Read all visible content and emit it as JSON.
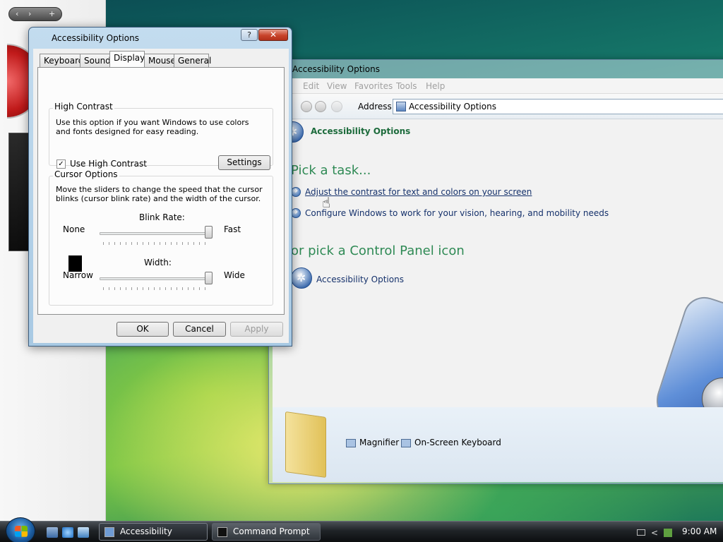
{
  "desktop": {
    "sidebar_controls": {
      "prev": "‹",
      "next": "›",
      "add": "+"
    }
  },
  "explorer": {
    "title": "Accessibility Options",
    "menu": [
      "Edit",
      "View",
      "Favorites",
      "Tools",
      "Help"
    ],
    "address_label": "Address",
    "address_value": "Accessibility Options",
    "header_link": "Accessibility Options",
    "pick_task": "Pick a task...",
    "tasks": [
      "Adjust the contrast for text and colors on your screen",
      "Configure Windows to work for your vision, hearing, and mobility needs"
    ],
    "pick_icon": "or pick a Control Panel icon",
    "cp_icon_label": "Accessibility Options",
    "bottom_items": [
      "Magnifier",
      "On-Screen Keyboard"
    ]
  },
  "dialog": {
    "title": "Accessibility Options",
    "help_glyph": "?",
    "close_glyph": "✕",
    "tabs": [
      "Keyboard",
      "Sound",
      "Display",
      "Mouse",
      "General"
    ],
    "active_tab": "Display",
    "high_contrast": {
      "group_title": "High Contrast",
      "description": "Use this option if you want Windows to use colors and fonts designed for easy reading.",
      "checkbox_label": "Use High Contrast",
      "checkbox_checked": true,
      "checkbox_glyph": "✓",
      "settings_button": "Settings"
    },
    "cursor_options": {
      "group_title": "Cursor Options",
      "description": "Move the sliders to change the speed that the cursor blinks (cursor blink rate) and the width of the cursor.",
      "blink_rate": {
        "label": "Blink Rate:",
        "min_label": "None",
        "max_label": "Fast",
        "value_fraction": 1.0
      },
      "width": {
        "label": "Width:",
        "min_label": "Narrow",
        "max_label": "Wide",
        "value_fraction": 1.0
      }
    },
    "buttons": {
      "ok": "OK",
      "cancel": "Cancel",
      "apply": "Apply"
    }
  },
  "taskbar": {
    "items": [
      {
        "label": "Accessibility Options",
        "active": true
      },
      {
        "label": "Command Prompt",
        "active": false
      }
    ],
    "tray_chevron": "<",
    "clock": "9:00 AM"
  },
  "colors": {
    "link_green": "#2f8a55",
    "link_blue": "#15316b",
    "close_red": "#c8432a"
  }
}
